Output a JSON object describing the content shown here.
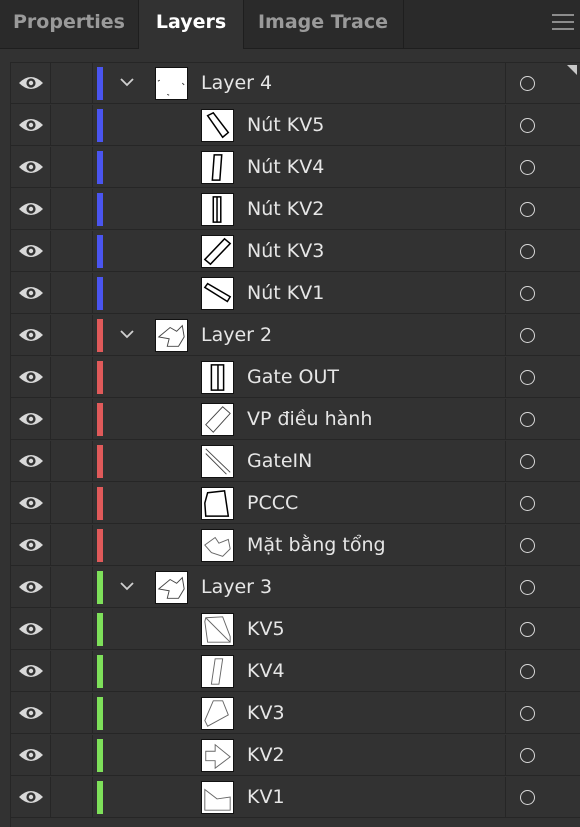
{
  "tabs": [
    {
      "label": "Properties",
      "active": false
    },
    {
      "label": "Layers",
      "active": true
    },
    {
      "label": "Image Trace",
      "active": false
    }
  ],
  "panel_menu_icon": "hamburger-menu-icon",
  "layers": [
    {
      "name": "Layer 4",
      "level": 0,
      "expanded": true,
      "color": "#4a55f0"
    },
    {
      "name": "Nút KV5",
      "level": 1,
      "color": "#4a55f0"
    },
    {
      "name": "Nút KV4",
      "level": 1,
      "color": "#4a55f0"
    },
    {
      "name": "Nút KV2",
      "level": 1,
      "color": "#4a55f0"
    },
    {
      "name": "Nút KV3",
      "level": 1,
      "color": "#4a55f0"
    },
    {
      "name": "Nút KV1",
      "level": 1,
      "color": "#4a55f0"
    },
    {
      "name": "Layer 2",
      "level": 0,
      "expanded": true,
      "color": "#e05a5a"
    },
    {
      "name": "Gate OUT",
      "level": 1,
      "color": "#e05a5a"
    },
    {
      "name": "VP điều hành",
      "level": 1,
      "color": "#e05a5a"
    },
    {
      "name": "GateIN",
      "level": 1,
      "color": "#e05a5a"
    },
    {
      "name": "PCCC",
      "level": 1,
      "color": "#e05a5a"
    },
    {
      "name": "Mặt bằng tổng",
      "level": 1,
      "color": "#e05a5a"
    },
    {
      "name": "Layer 3",
      "level": 0,
      "expanded": true,
      "color": "#7ee05a"
    },
    {
      "name": "KV5",
      "level": 1,
      "color": "#7ee05a"
    },
    {
      "name": "KV4",
      "level": 1,
      "color": "#7ee05a"
    },
    {
      "name": "KV3",
      "level": 1,
      "color": "#7ee05a"
    },
    {
      "name": "KV2",
      "level": 1,
      "color": "#7ee05a"
    },
    {
      "name": "KV1",
      "level": 1,
      "color": "#7ee05a"
    }
  ]
}
